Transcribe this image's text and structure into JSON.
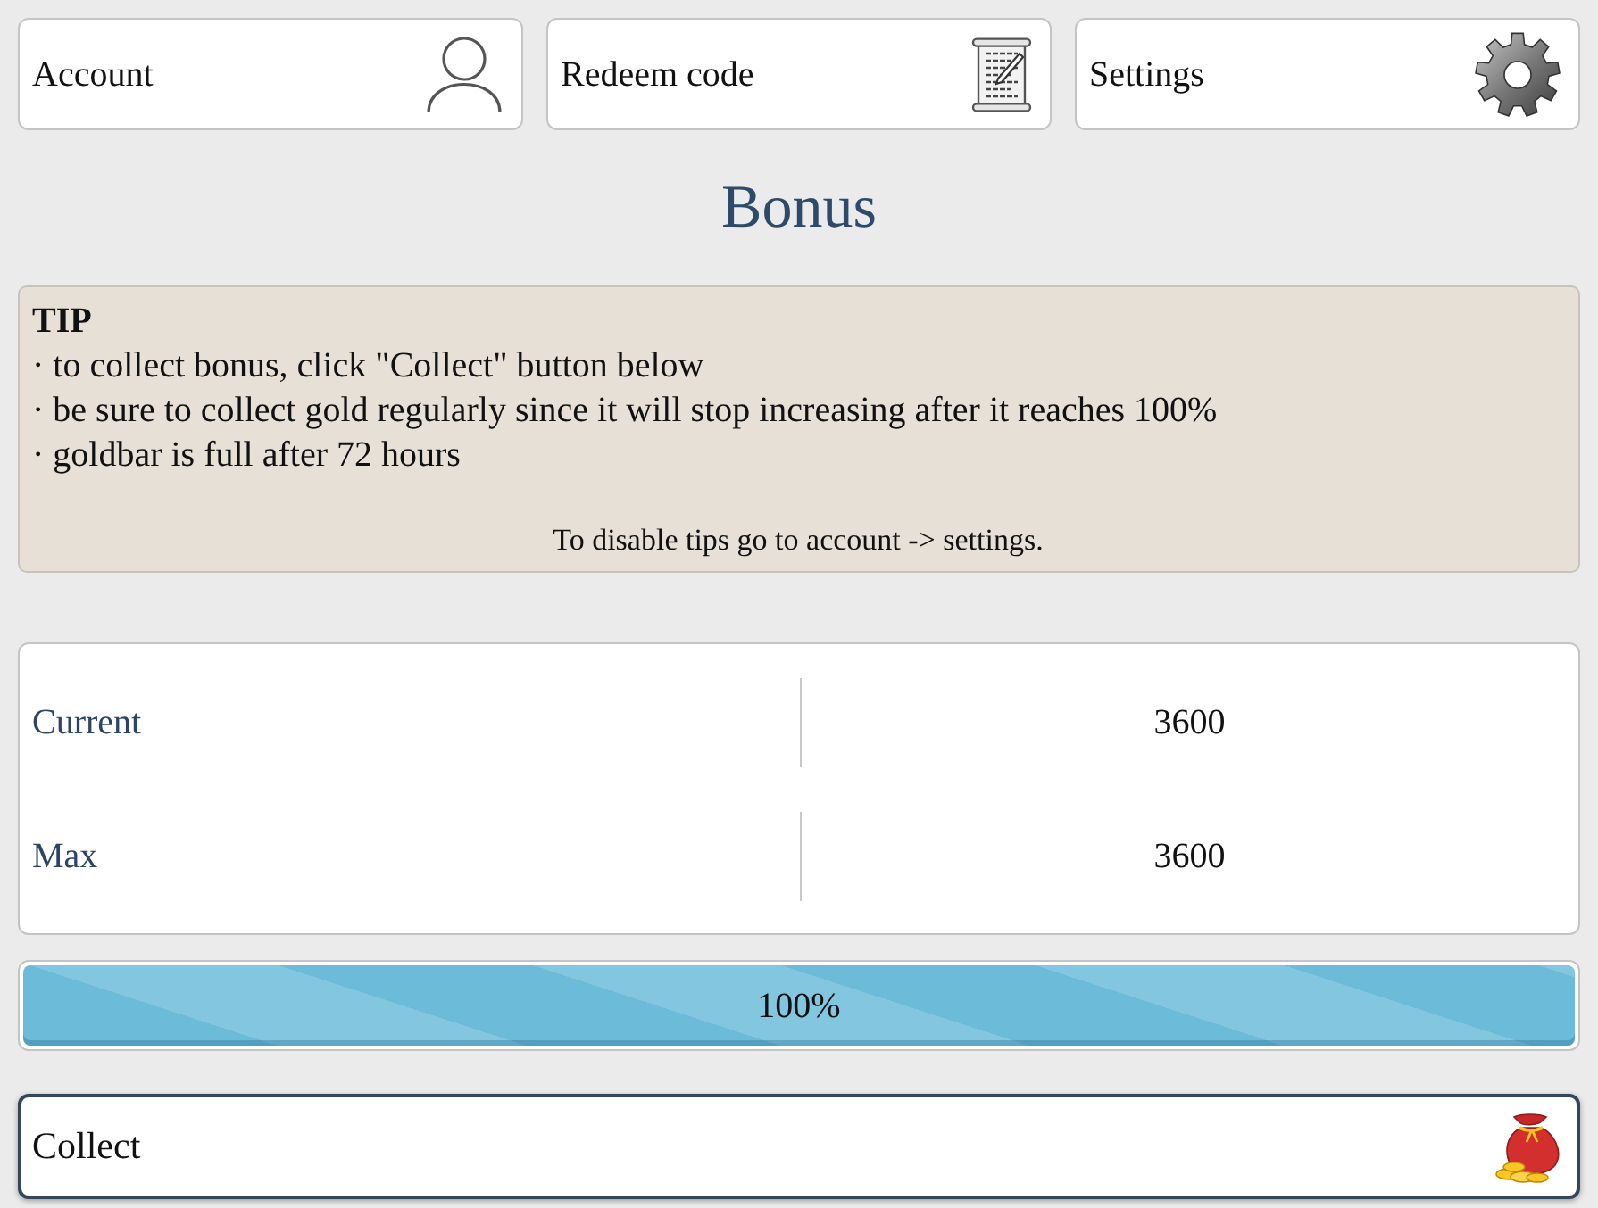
{
  "nav_buttons": [
    {
      "label": "Account",
      "kind": "account"
    },
    {
      "label": "Redeem code",
      "kind": "redeem"
    },
    {
      "label": "Settings",
      "kind": "settings"
    }
  ],
  "title": "Bonus",
  "tip": {
    "heading": "TIP",
    "lines": [
      "· to collect bonus, click \"Collect\" button below",
      "· be sure to collect gold regularly since it will stop increasing after it reaches 100%",
      "· goldbar is full after 72 hours"
    ],
    "footer": "To disable tips go to account -> settings."
  },
  "stats": [
    {
      "label": "Current",
      "value": "3600"
    },
    {
      "label": "Max",
      "value": "3600"
    }
  ],
  "progress": {
    "level": 1,
    "reading": "100%"
  },
  "collect_button": {
    "label": "Collect"
  }
}
